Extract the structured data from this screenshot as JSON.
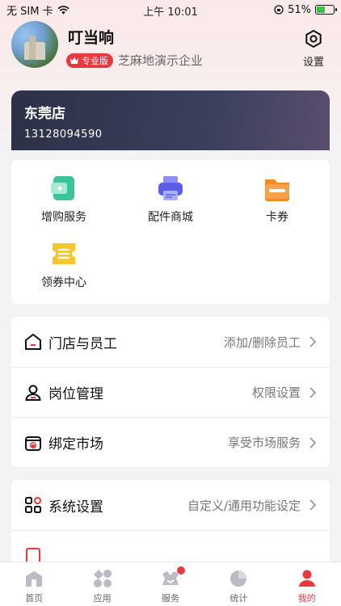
{
  "status_bar": {
    "carrier": "无 SIM 卡",
    "time": "上午 10:01",
    "battery": "51%",
    "battery_level": 0.51
  },
  "profile": {
    "name": "叮当响",
    "badge": "专业版",
    "company": "芝麻地演示企业",
    "settings_label": "设置"
  },
  "store": {
    "name": "东莞店",
    "phone": "13128094590"
  },
  "services": [
    {
      "label": "增购服务",
      "icon": "purchase-icon"
    },
    {
      "label": "配件商城",
      "icon": "printer-icon"
    },
    {
      "label": "卡券",
      "icon": "card-icon"
    },
    {
      "label": "领券中心",
      "icon": "coupon-icon"
    }
  ],
  "menu_group_1": [
    {
      "label": "门店与员工",
      "value": "添加/删除员工",
      "icon": "store-icon"
    },
    {
      "label": "岗位管理",
      "value": "权限设置",
      "icon": "person-icon"
    },
    {
      "label": "绑定市场",
      "value": "享受市场服务",
      "icon": "market-icon"
    }
  ],
  "menu_group_2": [
    {
      "label": "系统设置",
      "value": "自定义/通用功能设定",
      "icon": "grid-icon"
    }
  ],
  "tabbar": [
    {
      "label": "首页",
      "icon": "home-icon"
    },
    {
      "label": "应用",
      "icon": "apps-icon"
    },
    {
      "label": "服务",
      "icon": "service-icon"
    },
    {
      "label": "统计",
      "icon": "pie-icon"
    },
    {
      "label": "我的",
      "icon": "me-icon"
    }
  ],
  "colors": {
    "accent": "#e8393f",
    "card_dark": "#2d3147"
  }
}
